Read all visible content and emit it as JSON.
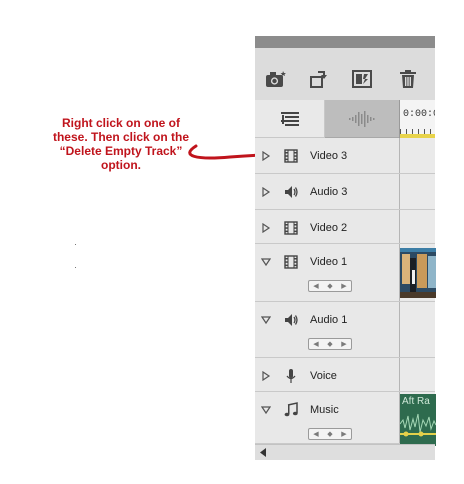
{
  "annotation": {
    "lines": [
      "Right click on one of",
      "these.  Then click on the",
      "“Delete Empty Track”",
      "option."
    ],
    "color": "#c0141c"
  },
  "toolbar": {
    "icons": [
      "camera-icon",
      "rotate-icon",
      "smart-fix-icon",
      "trash-icon"
    ]
  },
  "timeline": {
    "time_readout": "0:00:0"
  },
  "tracks": [
    {
      "name": "Video 3",
      "type": "video",
      "expanded": false
    },
    {
      "name": "Audio 3",
      "type": "audio",
      "expanded": false
    },
    {
      "name": "Video 2",
      "type": "video",
      "expanded": false
    },
    {
      "name": "Video 1",
      "type": "video",
      "expanded": true
    },
    {
      "name": "Audio 1",
      "type": "audio",
      "expanded": true
    },
    {
      "name": "Voice",
      "type": "voice",
      "expanded": false
    },
    {
      "name": "Music",
      "type": "music",
      "expanded": true
    }
  ],
  "clips": {
    "music_label": "Aft Ra"
  }
}
